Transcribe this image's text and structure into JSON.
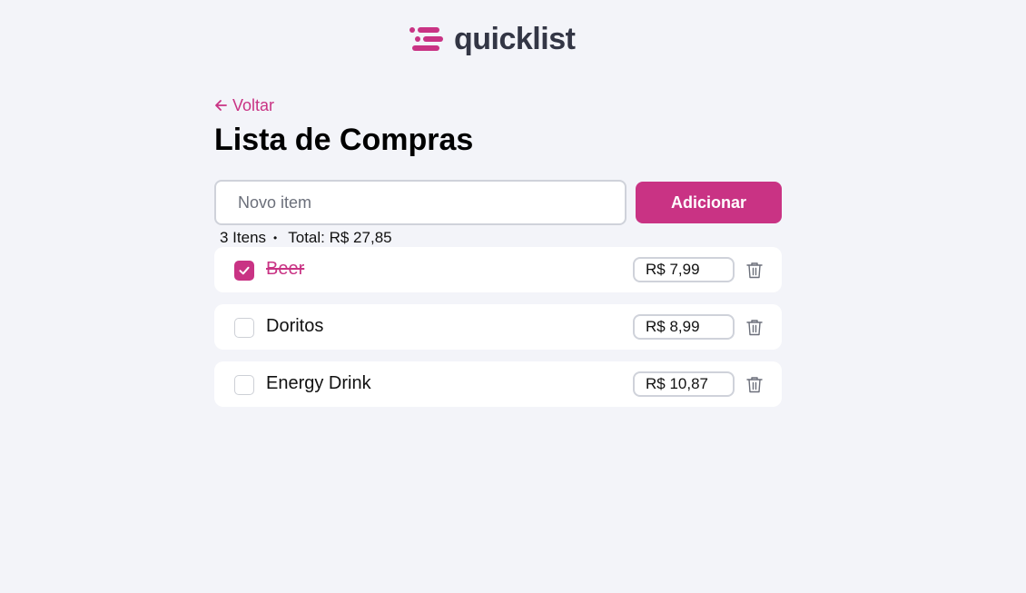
{
  "brand": {
    "name": "quicklist",
    "icon": "quicklist-logo-icon",
    "accent_color": "#c93384",
    "text_color": "#333645"
  },
  "nav": {
    "back_label": "Voltar",
    "back_icon": "arrow-left-icon"
  },
  "page": {
    "title": "Lista de Compras"
  },
  "add_form": {
    "placeholder": "Novo item",
    "value": "",
    "button_label": "Adicionar"
  },
  "summary": {
    "count_label": "3 Itens",
    "separator": "•",
    "total_label": "Total: R$ 27,85"
  },
  "items": [
    {
      "name": "Beer",
      "price": "R$ 7,99",
      "checked": true
    },
    {
      "name": "Doritos",
      "price": "R$ 8,99",
      "checked": false
    },
    {
      "name": "Energy Drink",
      "price": "R$ 10,87",
      "checked": false
    }
  ],
  "icons": {
    "check": "check-icon",
    "delete": "trash-icon"
  }
}
